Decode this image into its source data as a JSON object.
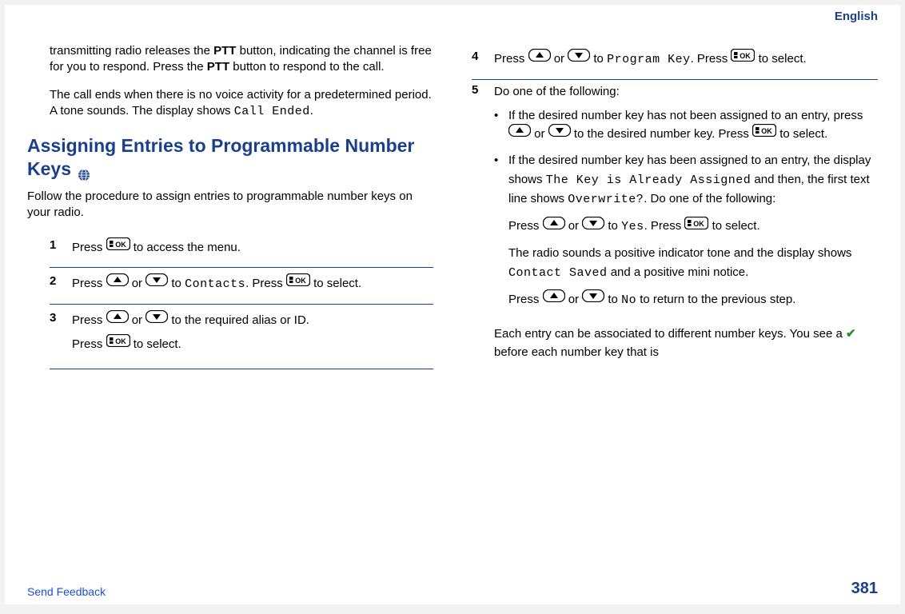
{
  "header": {
    "language": "English"
  },
  "left": {
    "para1_pre": "transmitting radio releases the ",
    "ptt": "PTT",
    "para1_mid": " button, indicating the channel is free for you to respond. Press the ",
    "para1_end": " button to respond to the call.",
    "para2_pre": "The call ends when there is no voice activity for a predetermined period. A tone sounds. The display shows ",
    "call_ended": "Call Ended",
    "period": ".",
    "heading": "Assigning Entries to Programmable Number Keys",
    "intro": "Follow the procedure to assign entries to programmable number keys on your radio.",
    "steps": {
      "s1": {
        "n": "1",
        "pre": "Press ",
        "post": " to access the menu."
      },
      "s2": {
        "n": "2",
        "pre": "Press ",
        "or": " or ",
        "to": " to ",
        "contacts": "Contacts",
        "press2": ". Press ",
        "post": " to select."
      },
      "s3": {
        "n": "3",
        "pre": "Press ",
        "or": " or ",
        "mid": " to the required alias or ID.",
        "line2pre": "Press ",
        "line2post": " to select."
      }
    }
  },
  "right": {
    "s4": {
      "n": "4",
      "pre": "Press ",
      "or": " or ",
      "to": " to ",
      "progkey": "Program Key",
      "press2": ". Press ",
      "post": " to select."
    },
    "s5": {
      "n": "5",
      "lead": "Do one of the following:",
      "b1": {
        "pre": "If the desired number key has not been assigned to an entry, press ",
        "or": " or ",
        "mid": " to the desired number key. Press ",
        "post": " to select."
      },
      "b2": {
        "pre": "If the desired number key has been assigned to an entry, the display shows ",
        "keyis": "The Key is Already Assigned",
        "mid1": " and then, the first text line shows ",
        "overwrite": "Overwrite?",
        "mid2": ". Do one of the following:",
        "p2pre": "Press ",
        "or": " or ",
        "to": " to ",
        "yes": "Yes",
        "press2": ". Press ",
        "p2post": " to select.",
        "p3pre": "The radio sounds a positive indicator tone and the display shows ",
        "saved": "Contact Saved",
        "p3post": " and a positive mini notice.",
        "p4pre": "Press ",
        "or4": " or ",
        "to4": " to ",
        "no": "No",
        "p4post": " to return to the previous step."
      },
      "tail": "Each entry can be associated to different number keys. You see a ",
      "tail2": " before each number key that is"
    }
  },
  "footer": {
    "feedback": "Send Feedback",
    "page": "381"
  }
}
